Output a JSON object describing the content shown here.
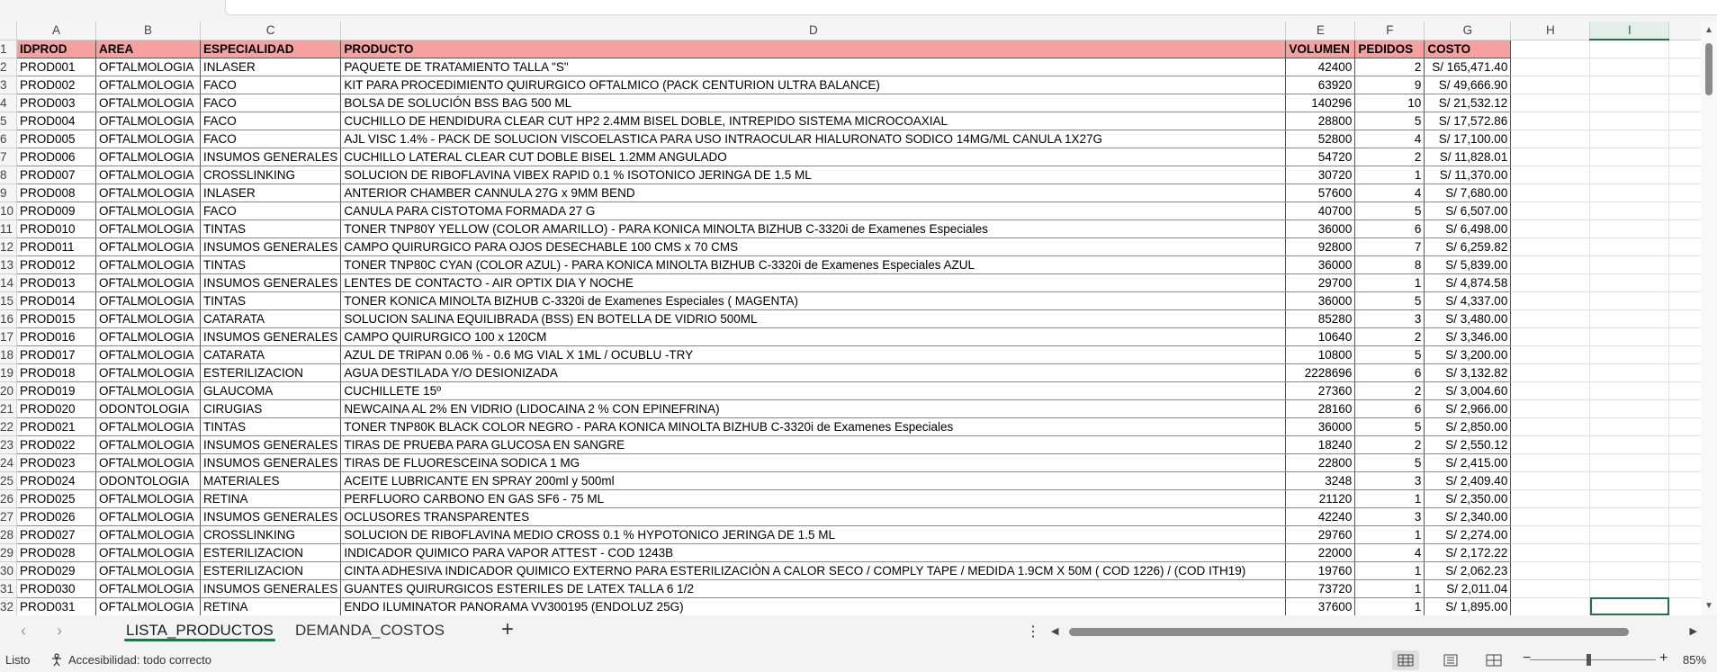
{
  "columns": [
    "A",
    "B",
    "C",
    "D",
    "E",
    "F",
    "G",
    "H",
    "I"
  ],
  "selected_column": "I",
  "header_row": {
    "row": "1",
    "IDPROD": "IDPROD",
    "AREA": "AREA",
    "ESPECIALIDAD": "ESPECIALIDAD",
    "PRODUCTO": "PRODUCTO",
    "VOLUMEN": "VOLUMEN",
    "PEDIDOS": "PEDIDOS",
    "COSTO": "COSTO"
  },
  "header_color": "#f6a0a0",
  "rows": [
    {
      "row": "2",
      "id": "PROD001",
      "area": "OFTALMOLOGIA",
      "esp": "INLASER",
      "producto": "PAQUETE DE TRATAMIENTO TALLA \"S\"",
      "volumen": "42400",
      "pedidos": "2",
      "costo": "S/ 165,471.40"
    },
    {
      "row": "3",
      "id": "PROD002",
      "area": "OFTALMOLOGIA",
      "esp": "FACO",
      "producto": "KIT PARA PROCEDIMIENTO QUIRURGICO OFTALMICO (PACK CENTURION ULTRA BALANCE)",
      "volumen": "63920",
      "pedidos": "9",
      "costo": "S/ 49,666.90"
    },
    {
      "row": "4",
      "id": "PROD003",
      "area": "OFTALMOLOGIA",
      "esp": "FACO",
      "producto": "BOLSA DE SOLUCIÓN BSS BAG 500 ML",
      "volumen": "140296",
      "pedidos": "10",
      "costo": "S/ 21,532.12"
    },
    {
      "row": "5",
      "id": "PROD004",
      "area": "OFTALMOLOGIA",
      "esp": "FACO",
      "producto": "CUCHILLO DE HENDIDURA CLEAR CUT HP2 2.4MM BISEL DOBLE, INTREPIDO SISTEMA MICROCOAXIAL",
      "volumen": "28800",
      "pedidos": "5",
      "costo": "S/ 17,572.86"
    },
    {
      "row": "6",
      "id": "PROD005",
      "area": "OFTALMOLOGIA",
      "esp": "FACO",
      "producto": "AJL VISC 1.4% - PACK DE SOLUCION VISCOELASTICA PARA USO INTRAOCULAR HIALURONATO SODICO 14MG/ML  CANULA 1X27G",
      "volumen": "52800",
      "pedidos": "4",
      "costo": "S/ 17,100.00"
    },
    {
      "row": "7",
      "id": "PROD006",
      "area": "OFTALMOLOGIA",
      "esp": "INSUMOS GENERALES",
      "producto": "CUCHILLO LATERAL CLEAR CUT DOBLE BISEL 1.2MM ANGULADO",
      "volumen": "54720",
      "pedidos": "2",
      "costo": "S/ 11,828.01"
    },
    {
      "row": "8",
      "id": "PROD007",
      "area": "OFTALMOLOGIA",
      "esp": "CROSSLINKING",
      "producto": "SOLUCION DE RIBOFLAVINA VIBEX RAPID 0.1 % ISOTONICO JERINGA DE 1.5 ML",
      "volumen": "30720",
      "pedidos": "1",
      "costo": "S/ 11,370.00"
    },
    {
      "row": "9",
      "id": "PROD008",
      "area": "OFTALMOLOGIA",
      "esp": "INLASER",
      "producto": "ANTERIOR CHAMBER CANNULA 27G x 9MM BEND",
      "volumen": "57600",
      "pedidos": "4",
      "costo": "S/ 7,680.00"
    },
    {
      "row": "10",
      "id": "PROD009",
      "area": "OFTALMOLOGIA",
      "esp": "FACO",
      "producto": "CANULA PARA CISTOTOMA FORMADA 27 G",
      "volumen": "40700",
      "pedidos": "5",
      "costo": "S/ 6,507.00"
    },
    {
      "row": "11",
      "id": "PROD010",
      "area": "OFTALMOLOGIA",
      "esp": "TINTAS",
      "producto": "TONER TNP80Y YELLOW (COLOR AMARILLO) - PARA KONICA MINOLTA BIZHUB C-3320i de Examenes Especiales",
      "volumen": "36000",
      "pedidos": "6",
      "costo": "S/ 6,498.00"
    },
    {
      "row": "12",
      "id": "PROD011",
      "area": "OFTALMOLOGIA",
      "esp": "INSUMOS GENERALES",
      "producto": "CAMPO QUIRURGICO PARA OJOS DESECHABLE 100 CMS x 70 CMS",
      "volumen": "92800",
      "pedidos": "7",
      "costo": "S/ 6,259.82"
    },
    {
      "row": "13",
      "id": "PROD012",
      "area": "OFTALMOLOGIA",
      "esp": "TINTAS",
      "producto": "TONER TNP80C CYAN (COLOR AZUL) - PARA KONICA MINOLTA BIZHUB C-3320i de Examenes Especiales AZUL",
      "volumen": "36000",
      "pedidos": "8",
      "costo": "S/ 5,839.00"
    },
    {
      "row": "14",
      "id": "PROD013",
      "area": "OFTALMOLOGIA",
      "esp": "INSUMOS GENERALES",
      "producto": "LENTES DE CONTACTO - AIR OPTIX DIA Y NOCHE",
      "volumen": "29700",
      "pedidos": "1",
      "costo": "S/ 4,874.58"
    },
    {
      "row": "15",
      "id": "PROD014",
      "area": "OFTALMOLOGIA",
      "esp": "TINTAS",
      "producto": "TONER KONICA MINOLTA BIZHUB C-3320i  de  Examenes Especiales ( MAGENTA)",
      "volumen": "36000",
      "pedidos": "5",
      "costo": "S/ 4,337.00"
    },
    {
      "row": "16",
      "id": "PROD015",
      "area": "OFTALMOLOGIA",
      "esp": "CATARATA",
      "producto": "SOLUCION SALINA EQUILIBRADA (BSS) EN BOTELLA DE VIDRIO 500ML",
      "volumen": "85280",
      "pedidos": "3",
      "costo": "S/ 3,480.00"
    },
    {
      "row": "17",
      "id": "PROD016",
      "area": "OFTALMOLOGIA",
      "esp": "INSUMOS GENERALES",
      "producto": "CAMPO QUIRURGICO 100 x 120CM",
      "volumen": "10640",
      "pedidos": "2",
      "costo": "S/ 3,346.00"
    },
    {
      "row": "18",
      "id": "PROD017",
      "area": "OFTALMOLOGIA",
      "esp": "CATARATA",
      "producto": "AZUL DE TRIPAN 0.06 % - 0.6 MG VIAL X 1ML / OCUBLU -TRY",
      "volumen": "10800",
      "pedidos": "5",
      "costo": "S/ 3,200.00"
    },
    {
      "row": "19",
      "id": "PROD018",
      "area": "OFTALMOLOGIA",
      "esp": "ESTERILIZACION",
      "producto": "AGUA DESTILADA Y/O DESIONIZADA",
      "volumen": "2228696",
      "pedidos": "6",
      "costo": "S/ 3,132.82"
    },
    {
      "row": "20",
      "id": "PROD019",
      "area": "OFTALMOLOGIA",
      "esp": "GLAUCOMA",
      "producto": "CUCHILLETE  15º",
      "volumen": "27360",
      "pedidos": "2",
      "costo": "S/ 3,004.60"
    },
    {
      "row": "21",
      "id": "PROD020",
      "area": "ODONTOLOGIA",
      "esp": "CIRUGIAS",
      "producto": "NEWCAINA AL 2% EN VIDRIO (LIDOCAINA 2 % CON EPINEFRINA)",
      "volumen": "28160",
      "pedidos": "6",
      "costo": "S/ 2,966.00"
    },
    {
      "row": "22",
      "id": "PROD021",
      "area": "OFTALMOLOGIA",
      "esp": "TINTAS",
      "producto": "TONER TNP80K BLACK COLOR NEGRO - PARA KONICA MINOLTA BIZHUB C-3320i de Examenes Especiales",
      "volumen": "36000",
      "pedidos": "5",
      "costo": "S/ 2,850.00"
    },
    {
      "row": "23",
      "id": "PROD022",
      "area": "OFTALMOLOGIA",
      "esp": "INSUMOS GENERALES",
      "producto": "TIRAS DE PRUEBA PARA GLUCOSA EN SANGRE",
      "volumen": "18240",
      "pedidos": "2",
      "costo": "S/ 2,550.12"
    },
    {
      "row": "24",
      "id": "PROD023",
      "area": "OFTALMOLOGIA",
      "esp": "INSUMOS GENERALES",
      "producto": "TIRAS DE FLUORESCEINA SODICA 1 MG",
      "volumen": "22800",
      "pedidos": "5",
      "costo": "S/ 2,415.00"
    },
    {
      "row": "25",
      "id": "PROD024",
      "area": "ODONTOLOGIA",
      "esp": "MATERIALES",
      "producto": "ACEITE LUBRICANTE EN SPRAY 200ml y 500ml",
      "volumen": "3248",
      "pedidos": "3",
      "costo": "S/ 2,409.40"
    },
    {
      "row": "26",
      "id": "PROD025",
      "area": "OFTALMOLOGIA",
      "esp": "RETINA",
      "producto": "PERFLUORO CARBONO EN GAS SF6 - 75 ML",
      "volumen": "21120",
      "pedidos": "1",
      "costo": "S/ 2,350.00"
    },
    {
      "row": "27",
      "id": "PROD026",
      "area": "OFTALMOLOGIA",
      "esp": "INSUMOS GENERALES",
      "producto": "OCLUSORES TRANSPARENTES",
      "volumen": "42240",
      "pedidos": "3",
      "costo": "S/ 2,340.00"
    },
    {
      "row": "28",
      "id": "PROD027",
      "area": "OFTALMOLOGIA",
      "esp": "CROSSLINKING",
      "producto": "SOLUCION DE RIBOFLAVINA MEDIO CROSS 0.1 % HYPOTONICO JERINGA DE 1.5 ML",
      "volumen": "29760",
      "pedidos": "1",
      "costo": "S/ 2,274.00"
    },
    {
      "row": "29",
      "id": "PROD028",
      "area": "OFTALMOLOGIA",
      "esp": "ESTERILIZACION",
      "producto": "INDICADOR QUIMICO PARA VAPOR  ATTEST - COD 1243B",
      "volumen": "22000",
      "pedidos": "4",
      "costo": "S/ 2,172.22"
    },
    {
      "row": "30",
      "id": "PROD029",
      "area": "OFTALMOLOGIA",
      "esp": "ESTERILIZACION",
      "producto": "CINTA ADHESIVA INDICADOR QUIMICO EXTERNO PARA ESTERILIZACIÒN A CALOR SECO / COMPLY TAPE / MEDIDA 1.9CM X 50M ( COD 1226) / (COD ITH19)",
      "volumen": "19760",
      "pedidos": "1",
      "costo": "S/ 2,062.23"
    },
    {
      "row": "31",
      "id": "PROD030",
      "area": "OFTALMOLOGIA",
      "esp": "INSUMOS GENERALES",
      "producto": "GUANTES QUIRURGICOS ESTERILES DE LATEX TALLA 6 1/2",
      "volumen": "73720",
      "pedidos": "1",
      "costo": "S/ 2,011.04"
    },
    {
      "row": "32",
      "id": "PROD031",
      "area": "OFTALMOLOGIA",
      "esp": "RETINA",
      "producto": "ENDO ILUMINATOR PANORAMA VV300195 (ENDOLUZ 25G)",
      "volumen": "37600",
      "pedidos": "1",
      "costo": "S/ 1,895.00"
    }
  ],
  "sheet_tabs": [
    {
      "label": "LISTA_PRODUCTOS",
      "active": true
    },
    {
      "label": "DEMANDA_COSTOS",
      "active": false
    }
  ],
  "nav": {
    "prev": "‹",
    "next": "›",
    "add": "+",
    "more": "⋮"
  },
  "status": {
    "ready": "Listo",
    "accessibility": "Accesibilidad: todo correcto",
    "zoom": "85%",
    "zoom_minus": "−",
    "zoom_plus": "+"
  },
  "accent_color": "#217346"
}
